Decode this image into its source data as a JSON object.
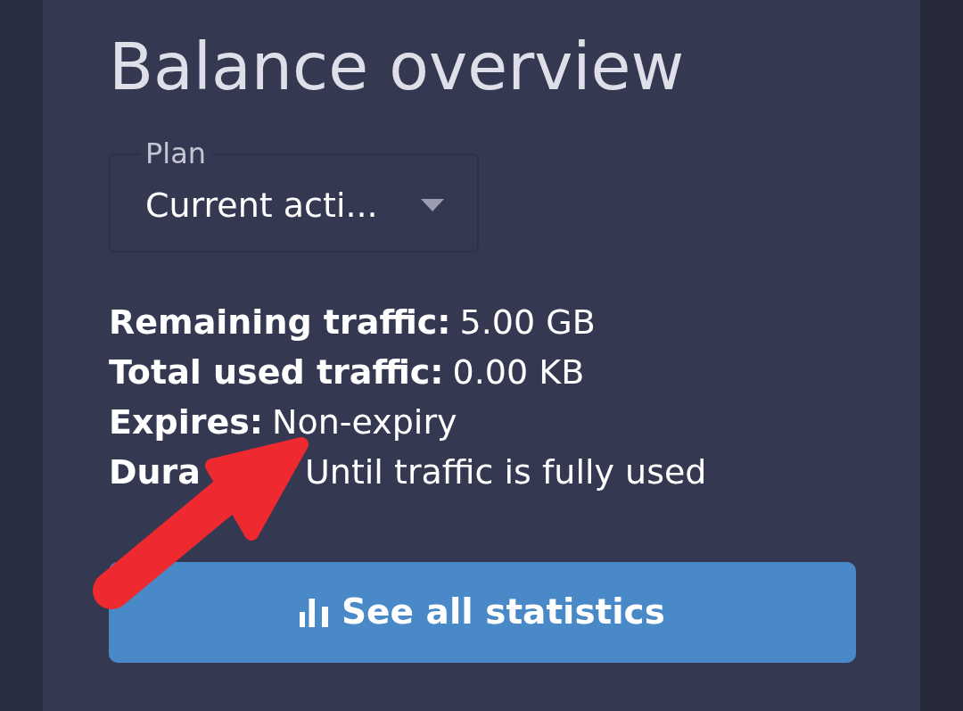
{
  "card": {
    "title": "Balance overview",
    "plan_select": {
      "label": "Plan",
      "value": "Current acti..."
    },
    "details": [
      {
        "kind": "plain",
        "label": "Remaining traffic:",
        "value": "5.00 GB"
      },
      {
        "kind": "plain",
        "label": "Total used traffic:",
        "value": "0.00 KB"
      },
      {
        "kind": "plain",
        "label": "Expires:",
        "value": "Non-expiry"
      },
      {
        "kind": "obscured",
        "label": "Dura",
        "value": "Until traffic is fully used"
      }
    ],
    "button": {
      "label": "See all statistics"
    }
  }
}
